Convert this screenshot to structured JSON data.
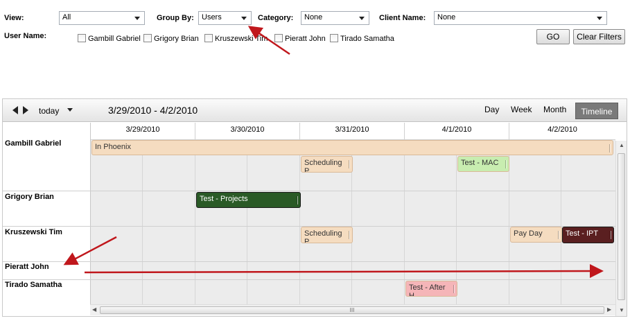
{
  "filters": {
    "view_label": "View:",
    "view_value": "All",
    "group_by_label": "Group By:",
    "group_by_value": "Users",
    "category_label": "Category:",
    "category_value": "None",
    "client_name_label": "Client Name:",
    "client_name_value": "None",
    "user_name_label": "User Name:",
    "users": [
      "Gambill Gabriel",
      "Grigory Brian",
      "Kruszewski Tim",
      "Pieratt John",
      "Tirado Samatha"
    ],
    "go_label": "GO",
    "clear_label": "Clear Filters"
  },
  "calendar": {
    "today_label": "today",
    "date_range": "3/29/2010 - 4/2/2010",
    "views": [
      "Day",
      "Week",
      "Month",
      "Timeline"
    ],
    "active_view": "Timeline",
    "days": [
      "3/29/2010",
      "3/30/2010",
      "3/31/2010",
      "4/1/2010",
      "4/2/2010"
    ],
    "rows": [
      "Gambill Gabriel",
      "Grigory Brian",
      "Kruszewski Tim",
      "Pieratt John",
      "Tirado Samatha"
    ],
    "events": [
      {
        "title": "In Phoenix",
        "color": "#f5dcc0"
      },
      {
        "title": "Scheduling\nP...",
        "color": "#f5dcc0"
      },
      {
        "title": "Test - MAC",
        "color": "#c8edb0"
      },
      {
        "title": "Test - Projects",
        "color": "#2a5a26"
      },
      {
        "title": "Scheduling\nP...",
        "color": "#f5dcc0"
      },
      {
        "title": "Pay Day",
        "color": "#f5dcc0"
      },
      {
        "title": "Test - IPT",
        "color": "#5a1f20"
      },
      {
        "title": "Test - After\nH...",
        "color": "#f5b5b8"
      }
    ],
    "scroll_grip": "III"
  },
  "annotations": {
    "arrow_color": "#c0171c"
  }
}
